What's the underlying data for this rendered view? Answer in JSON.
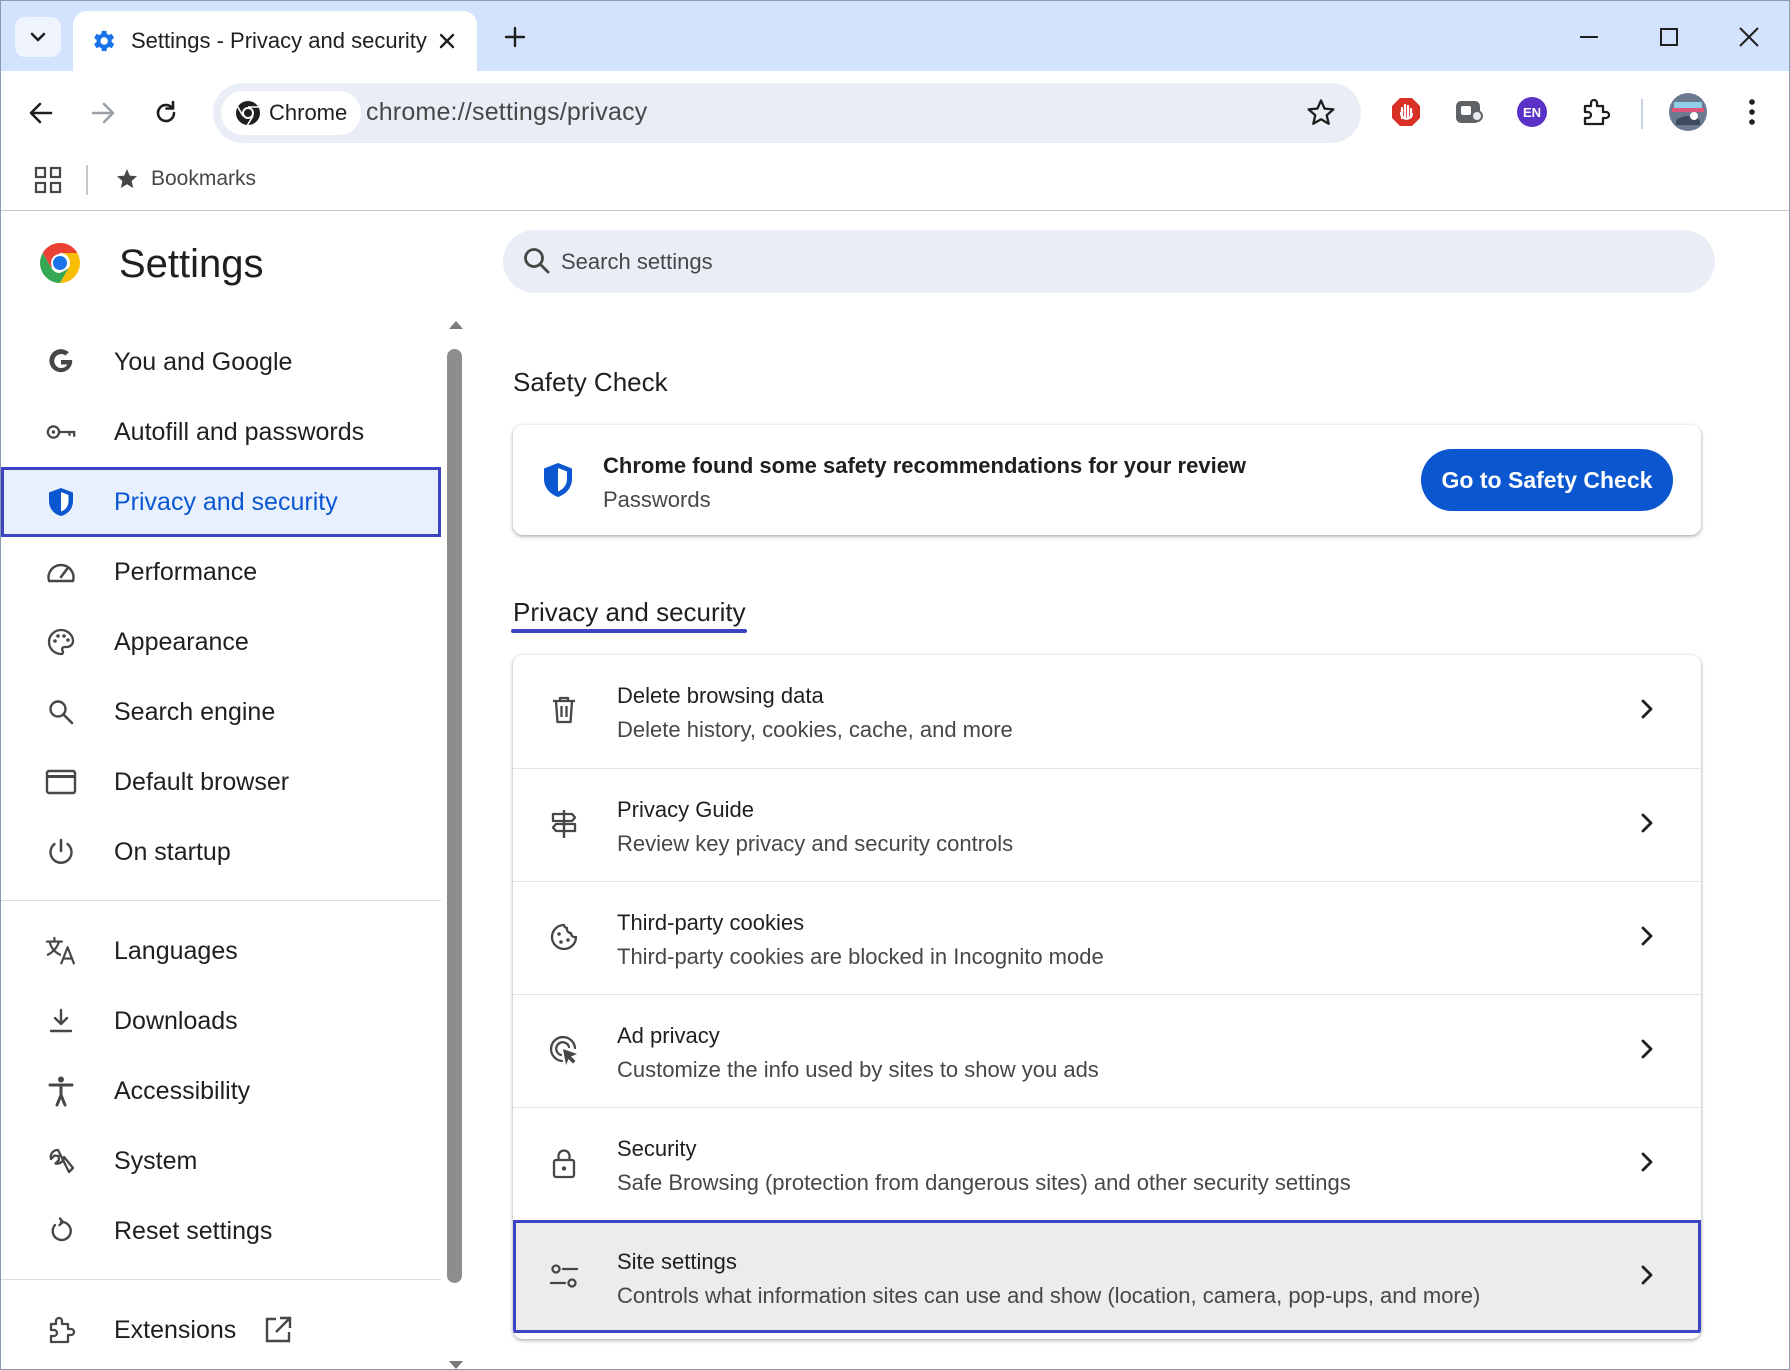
{
  "browser": {
    "tab_title": "Settings - Privacy and security",
    "chip_label": "Chrome",
    "url": "chrome://settings/privacy",
    "bookmarks_label": "Bookmarks",
    "extensions": [
      "adblock-icon",
      "screen-capture-icon",
      "en-translate-icon",
      "extensions-puzzle-icon"
    ],
    "en_badge": "EN"
  },
  "settings": {
    "title": "Settings",
    "search_placeholder": "Search settings"
  },
  "sidebar": {
    "items": [
      {
        "label": "You and Google",
        "icon": "google-g-icon"
      },
      {
        "label": "Autofill and passwords",
        "icon": "key-icon"
      },
      {
        "label": "Privacy and security",
        "icon": "shield-icon",
        "active": true
      },
      {
        "label": "Performance",
        "icon": "speedometer-icon"
      },
      {
        "label": "Appearance",
        "icon": "palette-icon"
      },
      {
        "label": "Search engine",
        "icon": "search-icon"
      },
      {
        "label": "Default browser",
        "icon": "browser-window-icon"
      },
      {
        "label": "On startup",
        "icon": "power-icon"
      },
      {
        "label": "Languages",
        "icon": "translate-icon"
      },
      {
        "label": "Downloads",
        "icon": "download-icon"
      },
      {
        "label": "Accessibility",
        "icon": "accessibility-icon"
      },
      {
        "label": "System",
        "icon": "wrench-icon"
      },
      {
        "label": "Reset settings",
        "icon": "reset-icon"
      },
      {
        "label": "Extensions",
        "icon": "puzzle-icon"
      }
    ]
  },
  "safety_check": {
    "section_title": "Safety Check",
    "primary": "Chrome found some safety recommendations for your review",
    "secondary": "Passwords",
    "button_label": "Go to Safety Check"
  },
  "privacy": {
    "section_title": "Privacy and security",
    "rows": [
      {
        "title": "Delete browsing data",
        "subtitle": "Delete history, cookies, cache, and more",
        "icon": "trash-icon"
      },
      {
        "title": "Privacy Guide",
        "subtitle": "Review key privacy and security controls",
        "icon": "signpost-icon"
      },
      {
        "title": "Third-party cookies",
        "subtitle": "Third-party cookies are blocked in Incognito mode",
        "icon": "cookie-icon"
      },
      {
        "title": "Ad privacy",
        "subtitle": "Customize the info used by sites to show you ads",
        "icon": "ad-target-icon"
      },
      {
        "title": "Security",
        "subtitle": "Safe Browsing (protection from dangerous sites) and other security settings",
        "icon": "lock-icon"
      },
      {
        "title": "Site settings",
        "subtitle": "Controls what information sites can use and show (location, camera, pop-ups, and more)",
        "icon": "tune-icon",
        "highlighted": true
      }
    ]
  },
  "colors": {
    "accent": "#0b57d0",
    "highlight_outline": "#3b45c4",
    "tabstrip": "#d3e3fd"
  }
}
